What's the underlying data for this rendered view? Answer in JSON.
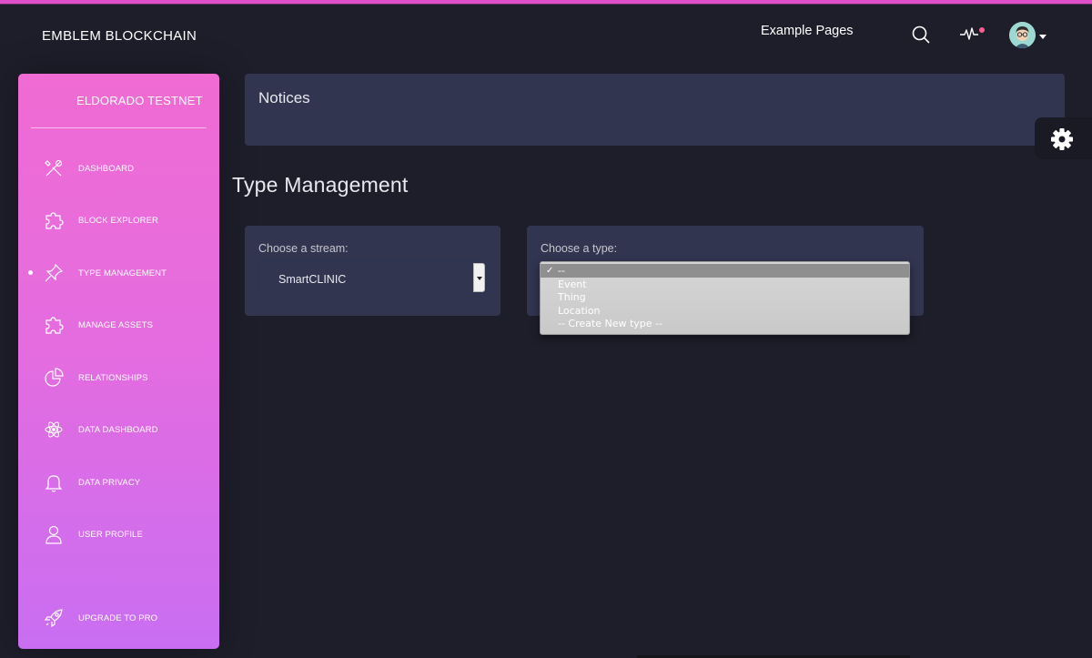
{
  "navbar": {
    "brand": "EMBLEM BLOCKCHAIN",
    "example_pages": "Example Pages"
  },
  "sidebar": {
    "title": "ELDORADO TESTNET",
    "items": [
      {
        "label": "DASHBOARD",
        "icon": "tools-icon"
      },
      {
        "label": "BLOCK EXPLORER",
        "icon": "puzzle-icon"
      },
      {
        "label": "TYPE MANAGEMENT",
        "icon": "pin-icon",
        "active": true
      },
      {
        "label": "MANAGE ASSETS",
        "icon": "puzzle-icon"
      },
      {
        "label": "RELATIONSHIPS",
        "icon": "pie-chart-icon"
      },
      {
        "label": "DATA DASHBOARD",
        "icon": "atom-icon"
      },
      {
        "label": "DATA PRIVACY",
        "icon": "bell-icon"
      },
      {
        "label": "USER PROFILE",
        "icon": "user-icon"
      },
      {
        "label": "UPGRADE TO PRO",
        "icon": "spaceship-icon"
      }
    ]
  },
  "notices": {
    "title": "Notices"
  },
  "page": {
    "title": "Type Management"
  },
  "stream": {
    "label": "Choose a stream:",
    "selected": "SmartCLINIC"
  },
  "type": {
    "label": "Choose a type:",
    "options": [
      "--",
      "Event",
      "Thing",
      "Location",
      "-- Create New type --"
    ],
    "selected_index": 0
  },
  "colors": {
    "accent": "#e14eca",
    "background": "#1e1e2b",
    "card": "#323550",
    "sidebar_top": "#f06bd3",
    "sidebar_bottom": "#c96ef2"
  }
}
